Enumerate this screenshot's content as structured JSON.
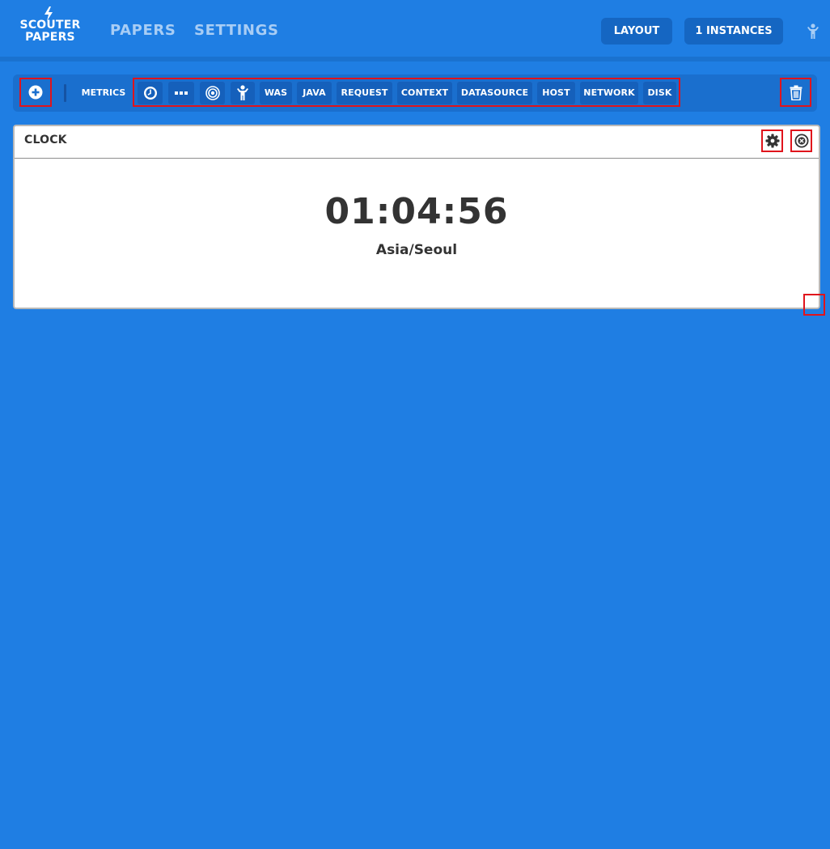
{
  "header": {
    "logo": {
      "line1": "SCOUTER",
      "line2": "PAPERS",
      "icon": "lightning-bolt-icon"
    },
    "nav": [
      {
        "label": "PAPERS"
      },
      {
        "label": "SETTINGS"
      }
    ],
    "layout_button": "LAYOUT",
    "instances_button": "1 INSTANCES",
    "user_icon": "user-icon"
  },
  "toolbar": {
    "add_icon": "plus-circle-icon",
    "metrics_label": "METRICS",
    "chips": [
      {
        "icon": "clock-icon"
      },
      {
        "icon": "ellipsis-icon"
      },
      {
        "icon": "target-icon"
      },
      {
        "icon": "user-icon"
      },
      {
        "label": "WAS"
      },
      {
        "label": "JAVA"
      },
      {
        "label": "REQUEST"
      },
      {
        "label": "CONTEXT"
      },
      {
        "label": "DATASOURCE"
      },
      {
        "label": "HOST"
      },
      {
        "label": "NETWORK"
      },
      {
        "label": "DISK"
      }
    ],
    "trash_icon": "trash-icon"
  },
  "clock_panel": {
    "title": "CLOCK",
    "settings_icon": "gear-icon",
    "close_icon": "close-circle-icon",
    "time": "01:04:56",
    "timezone": "Asia/Seoul"
  },
  "colors": {
    "background": "#1f7ee3",
    "toolbar": "#1a6fce",
    "chip": "#1560bb",
    "button": "#1566c2",
    "highlight": "#e0141c"
  }
}
